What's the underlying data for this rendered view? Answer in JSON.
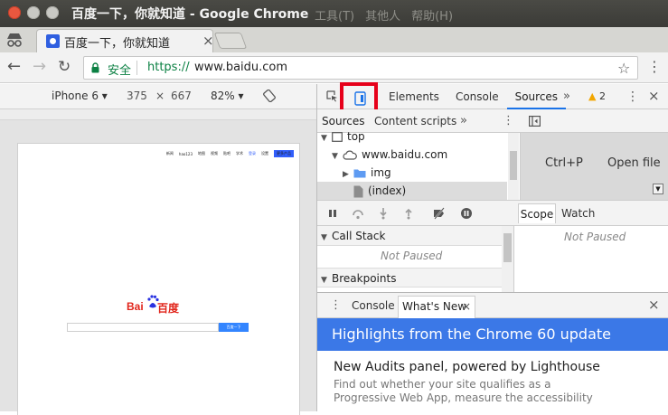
{
  "window": {
    "title": "百度一下，你就知道 - Google Chrome",
    "menu": [
      "工具(T)",
      "其他人",
      "帮助(H)"
    ]
  },
  "tab": {
    "title": "百度一下，你就知道",
    "close": "×"
  },
  "toolbar": {
    "back": "←",
    "forward": "→",
    "reload": "↻",
    "secure_label": "安全",
    "url_scheme": "https://",
    "url_host": "www.baidu.com",
    "star": "☆",
    "menu": "⋮"
  },
  "device_bar": {
    "device": "iPhone 6 ▾",
    "width": "375",
    "times": "×",
    "height": "667",
    "zoom": "82% ▾"
  },
  "emulated_page": {
    "nav": [
      "新闻",
      "hao123",
      "地图",
      "视频",
      "贴吧",
      "学术",
      "登录",
      "设置"
    ],
    "product_button": "更多产品",
    "logo_latin": "Bai",
    "logo_cjk": "百度",
    "search_button": "百度一下"
  },
  "devtools": {
    "tabs": [
      "Elements",
      "Console",
      "Sources"
    ],
    "active_tab": "Sources",
    "more": "»",
    "warnings": "2",
    "kebab": "⋮",
    "close": "×",
    "navigator": {
      "tab_sources": "Sources",
      "tab_content": "Content scripts",
      "more": "»",
      "kebab": "⋮",
      "tree": [
        {
          "label": "top",
          "indent": 0,
          "icon": "frame"
        },
        {
          "label": "www.baidu.com",
          "indent": 1,
          "icon": "cloud"
        },
        {
          "label": "img",
          "indent": 2,
          "icon": "folder"
        },
        {
          "label": "(index)",
          "indent": 2,
          "icon": "file"
        }
      ]
    },
    "editor": {
      "hint_shortcut": "Ctrl+P",
      "hint_action": "Open file"
    },
    "debugger": {
      "call_stack": "Call Stack",
      "call_stack_status": "Not Paused",
      "breakpoints": "Breakpoints"
    },
    "scope": {
      "tab_scope": "Scope",
      "tab_watch": "Watch",
      "status": "Not Paused"
    },
    "drawer": {
      "kebab": "⋮",
      "tab_console": "Console",
      "tab_whatsnew": "What's New",
      "tab_close": "×",
      "close": "×",
      "banner": "Highlights from the Chrome 60 update",
      "news_title": "New Audits panel, powered by Lighthouse",
      "news_desc": "Find out whether your site qualifies as a Progressive Web App, measure the accessibility"
    }
  },
  "colors": {
    "accent_blue": "#3b78e7",
    "secure_green": "#0b8043",
    "highlight_red": "#e6001a",
    "baidu_red": "#e1251b"
  }
}
